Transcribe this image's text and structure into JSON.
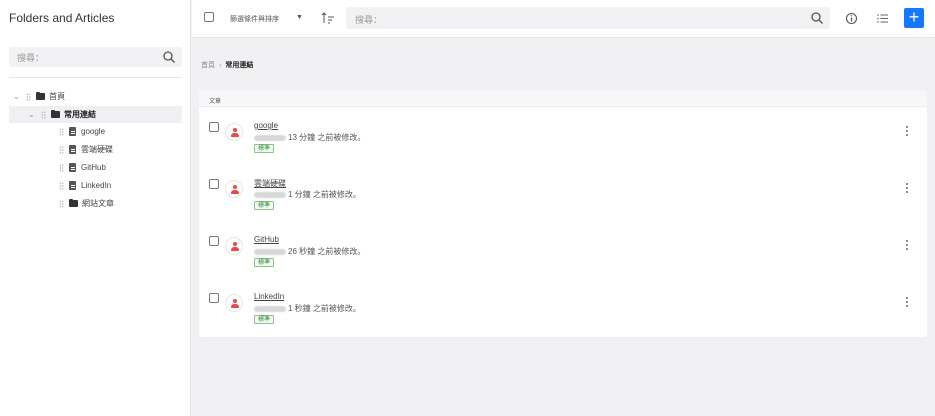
{
  "sidebar": {
    "title": "Folders and Articles",
    "search_placeholder": "搜尋：",
    "tree": [
      {
        "label": "首頁",
        "type": "folder"
      },
      {
        "label": "常用連結",
        "type": "folder"
      },
      {
        "label": "google",
        "type": "doc"
      },
      {
        "label": "雲端硬碟",
        "type": "doc"
      },
      {
        "label": "GitHub",
        "type": "doc"
      },
      {
        "label": "LinkedIn",
        "type": "doc"
      },
      {
        "label": "網站文章",
        "type": "folder"
      }
    ]
  },
  "topbar": {
    "filter_label": "篩選條件與排序",
    "caret": "▼",
    "search_placeholder": "搜尋："
  },
  "breadcrumb": {
    "home": "首頁",
    "separator": "›",
    "current": "常用連結"
  },
  "main": {
    "section_label": "文章",
    "articles": [
      {
        "title": "google",
        "modified": "13 分鐘 之前被修改。",
        "tag": "標準"
      },
      {
        "title": "雲端硬碟",
        "modified": "1 分鐘 之前被修改。",
        "tag": "標準"
      },
      {
        "title": "GitHub",
        "modified": "26 秒鐘 之前被修改。",
        "tag": "標準"
      },
      {
        "title": "LinkedIn",
        "modified": "1 秒鐘 之前被修改。",
        "tag": "標準"
      }
    ]
  },
  "colors": {
    "accent": "#1677ff",
    "avatar": "#e84a4a",
    "tag_green": "#3a8a3a"
  },
  "icons": [
    "search-icon",
    "folder-icon",
    "document-icon",
    "chevron-down-icon",
    "drag-handle-icon",
    "sort-icon",
    "info-icon",
    "list-view-icon",
    "plus-icon",
    "user-icon",
    "more-vertical-icon"
  ]
}
